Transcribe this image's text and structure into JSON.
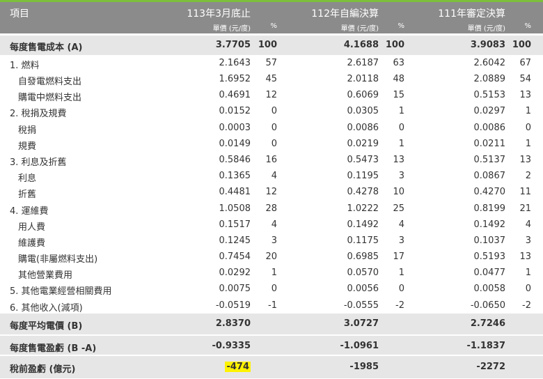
{
  "header": {
    "item_label": "項目",
    "col1_title": "113年3月底止",
    "col2_title": "112年自編決算",
    "col3_title": "111年審定決算",
    "unit_price": "單價 (元/度)",
    "pct": "%"
  },
  "rows": [
    {
      "label": "每度售電成本 (A)",
      "c1v": "3.7705",
      "c1p": "100",
      "c2v": "4.1688",
      "c2p": "100",
      "c3v": "3.9083",
      "c3p": "100"
    },
    {
      "label": "1. 燃料",
      "c1v": "2.1643",
      "c1p": "57",
      "c2v": "2.6187",
      "c2p": "63",
      "c3v": "2.6042",
      "c3p": "67"
    },
    {
      "label": "自發電燃料支出",
      "c1v": "1.6952",
      "c1p": "45",
      "c2v": "2.0118",
      "c2p": "48",
      "c3v": "2.0889",
      "c3p": "54"
    },
    {
      "label": "購電中燃料支出",
      "c1v": "0.4691",
      "c1p": "12",
      "c2v": "0.6069",
      "c2p": "15",
      "c3v": "0.5153",
      "c3p": "13"
    },
    {
      "label": "2. 稅捐及規費",
      "c1v": "0.0152",
      "c1p": "0",
      "c2v": "0.0305",
      "c2p": "1",
      "c3v": "0.0297",
      "c3p": "1"
    },
    {
      "label": "稅捐",
      "c1v": "0.0003",
      "c1p": "0",
      "c2v": "0.0086",
      "c2p": "0",
      "c3v": "0.0086",
      "c3p": "0"
    },
    {
      "label": "規費",
      "c1v": "0.0149",
      "c1p": "0",
      "c2v": "0.0219",
      "c2p": "1",
      "c3v": "0.0211",
      "c3p": "1"
    },
    {
      "label": "3. 利息及折舊",
      "c1v": "0.5846",
      "c1p": "16",
      "c2v": "0.5473",
      "c2p": "13",
      "c3v": "0.5137",
      "c3p": "13"
    },
    {
      "label": "利息",
      "c1v": "0.1365",
      "c1p": "4",
      "c2v": "0.1195",
      "c2p": "3",
      "c3v": "0.0867",
      "c3p": "2"
    },
    {
      "label": "折舊",
      "c1v": "0.4481",
      "c1p": "12",
      "c2v": "0.4278",
      "c2p": "10",
      "c3v": "0.4270",
      "c3p": "11"
    },
    {
      "label": "4. 運維費",
      "c1v": "1.0508",
      "c1p": "28",
      "c2v": "1.0222",
      "c2p": "25",
      "c3v": "0.8199",
      "c3p": "21"
    },
    {
      "label": "用人費",
      "c1v": "0.1517",
      "c1p": "4",
      "c2v": "0.1492",
      "c2p": "4",
      "c3v": "0.1492",
      "c3p": "4"
    },
    {
      "label": "維護費",
      "c1v": "0.1245",
      "c1p": "3",
      "c2v": "0.1175",
      "c2p": "3",
      "c3v": "0.1037",
      "c3p": "3"
    },
    {
      "label": "購電(非屬燃料支出)",
      "c1v": "0.7454",
      "c1p": "20",
      "c2v": "0.6985",
      "c2p": "17",
      "c3v": "0.5193",
      "c3p": "13"
    },
    {
      "label": "其他營業費用",
      "c1v": "0.0292",
      "c1p": "1",
      "c2v": "0.0570",
      "c2p": "1",
      "c3v": "0.0477",
      "c3p": "1"
    },
    {
      "label": "5. 其他電業經營相關費用",
      "c1v": "0.0075",
      "c1p": "0",
      "c2v": "0.0056",
      "c2p": "0",
      "c3v": "0.0058",
      "c3p": "0"
    },
    {
      "label": "6. 其他收入(減項)",
      "c1v": "-0.0519",
      "c1p": "-1",
      "c2v": "-0.0555",
      "c2p": "-2",
      "c3v": "-0.0650",
      "c3p": "-2"
    },
    {
      "label": "每度平均電價 (B)",
      "c1v": "2.8370",
      "c1p": "",
      "c2v": "3.0727",
      "c2p": "",
      "c3v": "2.7246",
      "c3p": ""
    },
    {
      "label": "每度售電盈虧 (B -A)",
      "c1v": "-0.9335",
      "c1p": "",
      "c2v": "-1.0961",
      "c2p": "",
      "c3v": "-1.1837",
      "c3p": ""
    },
    {
      "label": "稅前盈虧 (億元)",
      "c1v": "-474",
      "c1p": "",
      "c2v": "-1985",
      "c2p": "",
      "c3v": "-2272",
      "c3p": ""
    }
  ]
}
